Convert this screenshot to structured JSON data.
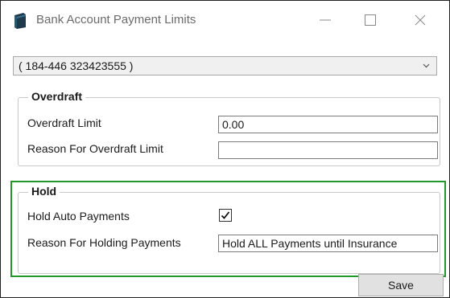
{
  "window": {
    "title": "Bank Account Payment Limits",
    "icon": "bank-database-icon",
    "controls": [
      "minimize-icon",
      "maximize-icon",
      "close-icon"
    ]
  },
  "account_select": {
    "value": "( 184-446 323423555 )",
    "icon": "chevron-down-icon"
  },
  "overdraft": {
    "legend": "Overdraft",
    "limit_label": "Overdraft Limit",
    "limit_value": "0.00",
    "reason_label": "Reason For Overdraft Limit",
    "reason_value": ""
  },
  "hold": {
    "legend": "Hold",
    "auto_label": "Hold Auto Payments",
    "auto_checked": true,
    "reason_label": "Reason For Holding Payments",
    "reason_value": "Hold ALL Payments until Insurance"
  },
  "footer": {
    "save_label": "Save"
  },
  "colors": {
    "highlight": "#23962c",
    "title_text": "#6b6b6b",
    "app_icon": "#1f3a4d"
  }
}
